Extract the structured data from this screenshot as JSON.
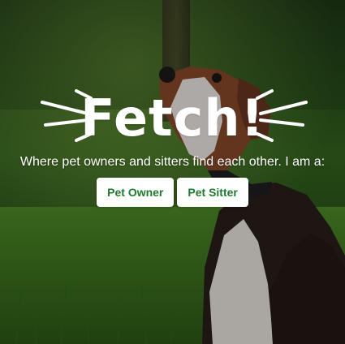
{
  "hero": {
    "logo_text": "Fetch!",
    "tagline": "Where pet owners and sitters find each other. I am a:",
    "pet_owner_button": "Pet Owner",
    "pet_sitter_button": "Pet Sitter",
    "colors": {
      "button_text": "#1f7a2e",
      "button_bg": "#ffffff",
      "overlay_text": "#ffffff"
    },
    "background_image": "beagle-sitting-in-grass"
  }
}
